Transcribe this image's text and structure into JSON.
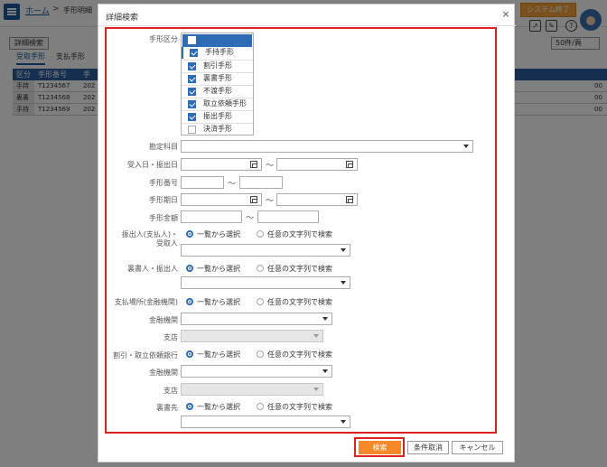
{
  "background": {
    "breadcrumb": {
      "home": "ホーム",
      "sep": ">",
      "current": "手形明細"
    },
    "system_end": "システム終了",
    "advanced_search": "詳細検索",
    "tabs": [
      "受取手形",
      "支払手形"
    ],
    "per_page": "50件/頁",
    "table": {
      "headers": [
        "区分",
        "手形番号",
        "手"
      ],
      "rows": [
        [
          "手持",
          "T1234567",
          "202",
          "00"
        ],
        [
          "裏書",
          "T1234568",
          "202",
          "00"
        ],
        [
          "手持",
          "T1234569",
          "202",
          "00"
        ]
      ]
    }
  },
  "dialog": {
    "title": "詳細検索",
    "close": "×",
    "fields": {
      "tegata_kubun": "手形区分",
      "kanjo_kamoku": "勘定科目",
      "ukeire_date": "受入日・振出日",
      "tegata_no": "手形番号",
      "tegata_kijitsu": "手形期日",
      "tegata_kingaku": "手形金額",
      "furidashi_l1": "振出人(支払人)・",
      "furidashi_l2": "受取人",
      "uragaki": "裏書人・振出人",
      "shiharai_basho": "支払場所(金融機関)",
      "kinyu_kikan_1": "金融機関",
      "shiten_1": "支店",
      "waribiki_bank": "割引・取立依頼銀行",
      "kinyu_kikan_2": "金融機関",
      "shiten_2": "支店",
      "uragakisaki": "裏書先"
    },
    "tilde": "～",
    "radio_list": "一覧から選択",
    "radio_text": "任意の文字列で検索",
    "kubun_options": [
      {
        "label": "手持手形",
        "checked": true
      },
      {
        "label": "割引手形",
        "checked": true
      },
      {
        "label": "裏書手形",
        "checked": true
      },
      {
        "label": "不渡手形",
        "checked": true
      },
      {
        "label": "取立依頼手形",
        "checked": true
      },
      {
        "label": "振出手形",
        "checked": true
      },
      {
        "label": "決済手形",
        "checked": false
      }
    ],
    "buttons": {
      "search": "検索",
      "clear": "条件取消",
      "cancel": "キャンセル"
    }
  },
  "colors": {
    "accent": "#2d6db5",
    "search_button": "#f5892a",
    "highlight": "#e02020"
  }
}
